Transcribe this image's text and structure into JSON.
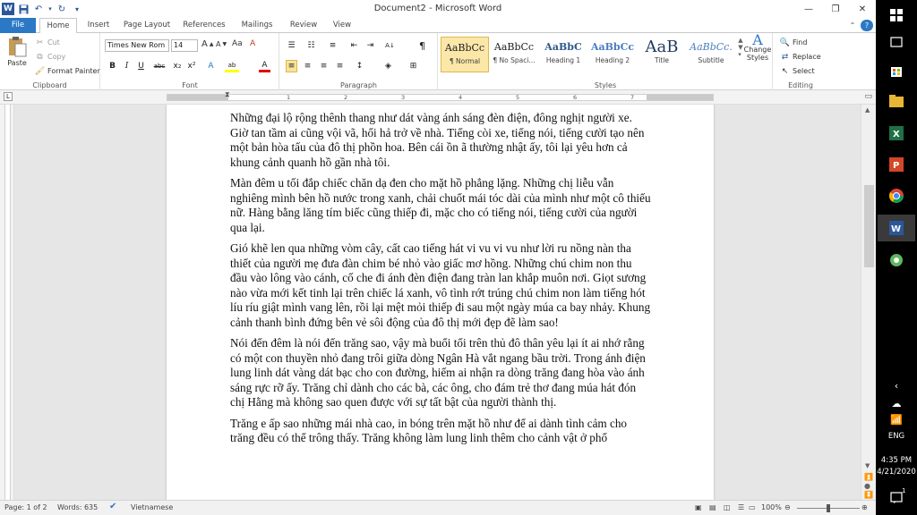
{
  "window": {
    "title": "Document2 - Microsoft Word",
    "controls": {
      "minimize": "—",
      "restore": "❐",
      "close": "✕"
    }
  },
  "qat": {
    "word_icon": "W",
    "save": "💾",
    "undo": "↶",
    "redo": "↻",
    "more": "▾"
  },
  "tabs": [
    "File",
    "Home",
    "Insert",
    "Page Layout",
    "References",
    "Mailings",
    "Review",
    "View"
  ],
  "ribbon": {
    "clipboard": {
      "label": "Clipboard",
      "paste": "Paste",
      "cut": "Cut",
      "copy": "Copy",
      "format_painter": "Format Painter"
    },
    "font": {
      "label": "Font",
      "family": "Times New Rom",
      "size": "14",
      "grow": "A",
      "shrink": "A",
      "aa": "Aa",
      "clear": "A",
      "bold": "B",
      "italic": "I",
      "underline": "U",
      "strike": "abc",
      "sub": "x₂",
      "sup": "x²",
      "effects": "A",
      "highlight": "ab",
      "color": "A"
    },
    "paragraph": {
      "label": "Paragraph",
      "pilcrow": "¶"
    },
    "styles": {
      "label": "Styles",
      "tiles": [
        {
          "sample": "AaBbCc",
          "name": "¶ Normal"
        },
        {
          "sample": "AaBbCc",
          "name": "¶ No Spaci..."
        },
        {
          "sample": "AaBbC",
          "name": "Heading 1"
        },
        {
          "sample": "AaBbCc",
          "name": "Heading 2"
        },
        {
          "sample": "AaB",
          "name": "Title"
        },
        {
          "sample": "AaBbCc.",
          "name": "Subtitle"
        }
      ],
      "change_styles": "Change Styles"
    },
    "editing": {
      "label": "Editing",
      "find": "Find",
      "replace": "Replace",
      "select": "Select"
    }
  },
  "ruler": {
    "numbers": [
      "1",
      "2",
      "3",
      "4",
      "5",
      "6",
      "7"
    ]
  },
  "document": {
    "paragraphs": [
      "Những đại lộ rộng thênh thang như dát vàng ánh sáng đèn điện, đông nghịt người xe. Giờ tan tầm ai cũng vội vã, hối hả trở về nhà. Tiếng còi xe, tiếng nói, tiếng cười tạo nên một bản hòa tấu của đô thị phồn hoa. Bên cái ồn ã thường nhật ấy, tôi lại yêu hơn cả khung cảnh quanh hồ gần nhà tôi.",
      "Màn đêm u tối đắp chiếc chăn dạ đen cho mặt hồ phẳng lặng. Những chị liễu vẫn nghiêng mình bên hồ nước trong xanh, chải chuốt mái tóc dài của mình như một cô thiếu nữ. Hàng bằng lăng tím biếc cũng thiếp đi, mặc cho có tiếng nói, tiếng cười của người qua lại.",
      "Gió khẽ len qua những vòm cây, cất cao tiếng hát vi vu vi vu như lời ru nồng nàn tha thiết của người mẹ đưa đàn chim bé nhỏ vào giấc mơ hồng. Những chú chim non thu đầu vào lông vào cánh, cố che đi ánh đèn điện đang tràn lan khắp muôn nơi. Giọt sương nào vừa mới kết tinh lại trên chiếc lá xanh, vô tình rớt trúng chú chim non làm tiếng hót líu ríu giật mình vang lên, rồi lại mệt mỏi thiếp đi sau một ngày múa ca bay nhảy. Khung cảnh thanh bình đứng bên vẻ sôi động của đô thị mới đẹp đẽ làm sao!",
      "Nói đến đêm là nói đến trăng sao, vậy mà buổi tối trên thủ đô thân yêu lại ít ai nhớ rằng có một con thuyền nhỏ đang trôi giữa dòng Ngân Hà vắt ngang bầu trời. Trong ánh điện lung linh dát vàng dát bạc cho con đường, hiếm ai nhận ra dòng trăng đang hòa vào ánh sáng rực rỡ ấy. Trăng chỉ dành cho các bà, các ông, cho đám trẻ thơ đang múa hát đón chị Hằng mà không sao quen được với sự tất bật của người thành thị.",
      "Trăng e ấp sao những mái nhà cao, in bóng trên mặt hồ như để ai dành tình cảm cho trăng đều có thể trông thấy. Trăng không làm lung linh thêm cho cảnh vật ở phố"
    ]
  },
  "status": {
    "page": "Page: 1 of 2",
    "words": "Words: 635",
    "language": "Vietnamese",
    "zoom": "100%"
  },
  "taskbar": {
    "time": "4:35 PM",
    "date": "4/21/2020",
    "lang": "ENG",
    "notif": "1"
  }
}
